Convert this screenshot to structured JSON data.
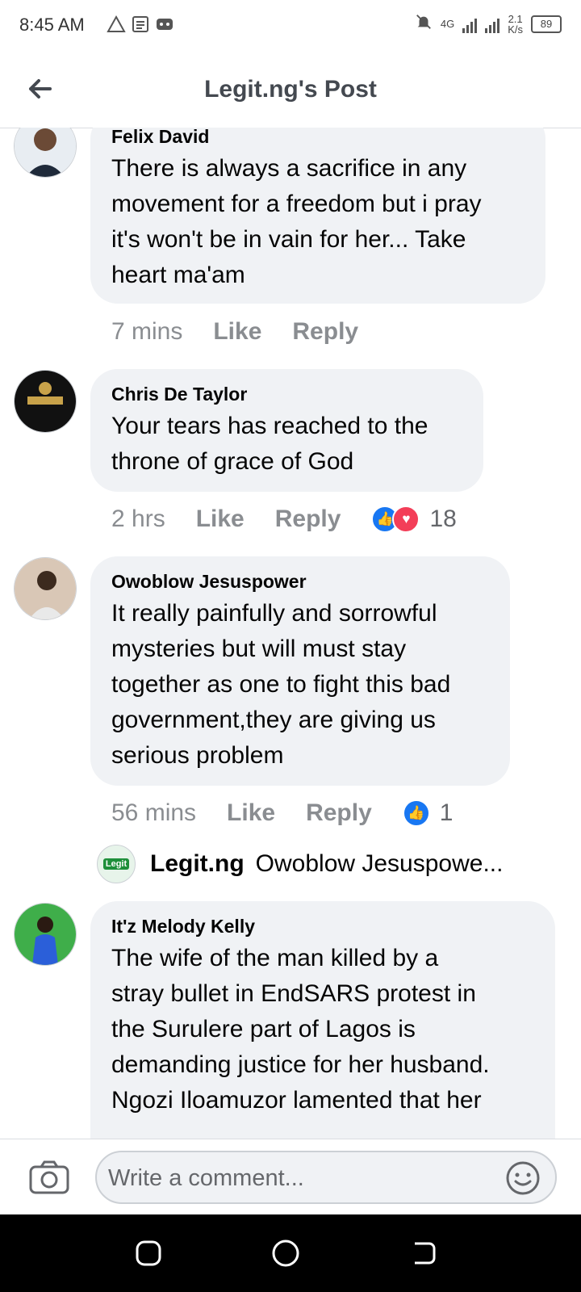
{
  "status_bar": {
    "time": "8:45 AM",
    "network": "4G",
    "speed_value": "2.1",
    "speed_unit": "K/s",
    "battery": "89",
    "icons": [
      "alert-triangle-icon",
      "news-icon",
      "gamepad-icon",
      "bell-muted-icon",
      "signal-icon"
    ]
  },
  "header": {
    "title": "Legit.ng's Post",
    "back_icon": "back-arrow-icon"
  },
  "comments": [
    {
      "author": "Felix David",
      "lines": [
        "There is always a sacrifice in any",
        "movement for a freedom but i pray",
        "it's won't be in vain for her... Take",
        "heart ma'am"
      ],
      "time": "7 mins",
      "like": "Like",
      "reply": "Reply",
      "reactions": null
    },
    {
      "author": "Chris De Taylor",
      "lines": [
        "Your tears has reached to the",
        "throne of grace of God"
      ],
      "time": "2 hrs",
      "like": "Like",
      "reply": "Reply",
      "reactions": "18"
    },
    {
      "author": "Owoblow Jesuspower",
      "lines": [
        "It really painfully and sorrowful",
        "mysteries but will must stay",
        "together as one to fight this bad",
        "government,they are giving us",
        "serious problem"
      ],
      "time": "56 mins",
      "like": "Like",
      "reply": "Reply",
      "reactions": "1"
    },
    {
      "author": "It'z Melody Kelly",
      "lines": [
        "The wife of the man killed by a",
        "stray bullet in EndSARS protest in",
        "the Surulere part of Lagos is",
        "demanding justice for her husband.",
        "Ngozi Iloamuzor lamented that her"
      ]
    }
  ],
  "reply_preview": {
    "name": "Legit.ng",
    "text": "Owoblow Jesuspowe...",
    "logo_text": "Legit"
  },
  "composer": {
    "placeholder": "Write a comment...",
    "camera_icon": "camera-icon",
    "emoji_icon": "emoji-icon"
  },
  "colors": {
    "bubble": "#f0f2f5",
    "like_blue": "#1877f2",
    "love_red": "#f33e58",
    "meta_gray": "#8a8d91"
  }
}
